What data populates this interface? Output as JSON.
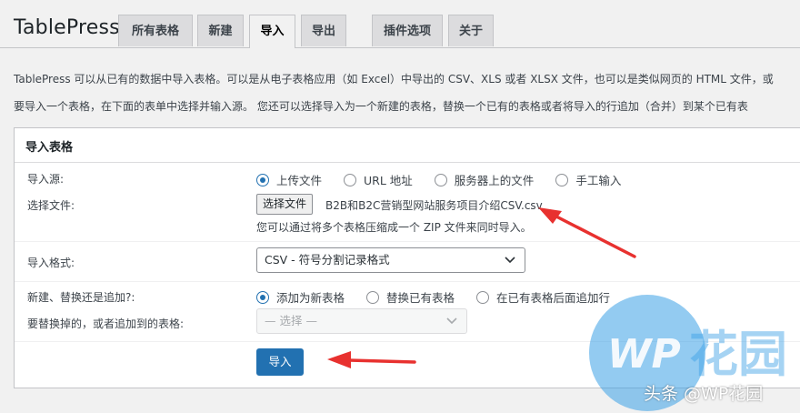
{
  "app_title": "TablePress",
  "tabs": [
    {
      "label": "所有表格",
      "active": false
    },
    {
      "label": "新建",
      "active": false
    },
    {
      "label": "导入",
      "active": true
    },
    {
      "label": "导出",
      "active": false
    },
    {
      "label": "插件选项",
      "active": false
    },
    {
      "label": "关于",
      "active": false
    }
  ],
  "intro": {
    "line1": "TablePress 可以从已有的数据中导入表格。可以是从电子表格应用（如 Excel）中导出的 CSV、XLS 或者 XLSX 文件，也可以是类似网页的 HTML 文件，或",
    "line2": "要导入一个表格，在下面的表单中选择并输入源。 您还可以选择导入为一个新建的表格，替换一个已有的表格或者将导入的行追加（合并）到某个已有表"
  },
  "panel": {
    "title": "导入表格",
    "source": {
      "label": "导入源:",
      "options": [
        "上传文件",
        "URL 地址",
        "服务器上的文件",
        "手工输入"
      ],
      "selected": "上传文件"
    },
    "file": {
      "label": "选择文件:",
      "button_label": "选择文件",
      "file_name": "B2B和B2C营销型网站服务项目介绍CSV.csv",
      "hint": "您可以通过将多个表格压缩成一个 ZIP 文件来同时导入。"
    },
    "format": {
      "label": "导入格式:",
      "selected": "CSV - 符号分割记录格式"
    },
    "mode": {
      "label": "新建、替换还是追加?:",
      "options": [
        "添加为新表格",
        "替换已有表格",
        "在已有表格后面追加行"
      ],
      "selected": "添加为新表格"
    },
    "target": {
      "label": "要替换掉的，或者追加到的表格:",
      "placeholder": "— 选择 —"
    },
    "import_button_label": "导入"
  },
  "watermark": {
    "logo_text": "WP花园",
    "text": "头条 @WP花园"
  },
  "colors": {
    "primary": "#2271b1",
    "annotation_arrow": "#e8312f",
    "watermark": "#3aa0e6"
  }
}
